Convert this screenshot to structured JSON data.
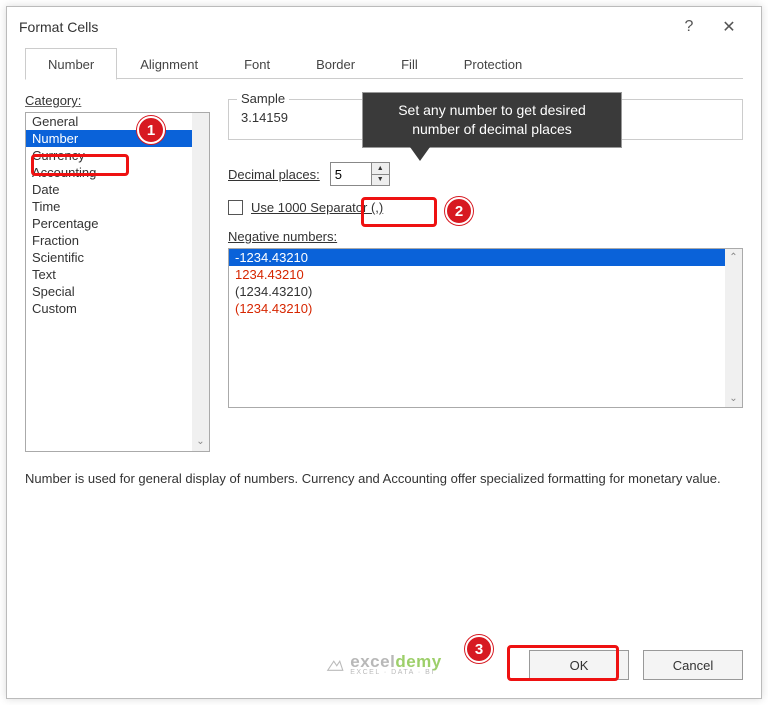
{
  "dialog": {
    "title": "Format Cells"
  },
  "tabs": [
    "Number",
    "Alignment",
    "Font",
    "Border",
    "Fill",
    "Protection"
  ],
  "active_tab": 0,
  "category_label": "Category:",
  "categories": [
    "General",
    "Number",
    "Currency",
    "Accounting",
    "Date",
    "Time",
    "Percentage",
    "Fraction",
    "Scientific",
    "Text",
    "Special",
    "Custom"
  ],
  "selected_category": 1,
  "sample": {
    "legend": "Sample",
    "value": "3.14159"
  },
  "decimal": {
    "label": "Decimal places:",
    "value": "5"
  },
  "separator": {
    "label": "Use 1000 Separator (,)",
    "checked": false
  },
  "negative": {
    "label": "Negative numbers:",
    "items": [
      {
        "text": "-1234.43210",
        "red": false,
        "selected": true
      },
      {
        "text": "1234.43210",
        "red": true,
        "selected": false
      },
      {
        "text": "(1234.43210)",
        "red": false,
        "selected": false
      },
      {
        "text": "(1234.43210)",
        "red": true,
        "selected": false
      }
    ]
  },
  "description": "Number is used for general display of numbers.  Currency and Accounting offer specialized formatting for monetary value.",
  "buttons": {
    "ok": "OK",
    "cancel": "Cancel"
  },
  "callout": "Set any number to get desired number of decimal places",
  "markers": {
    "one": "1",
    "two": "2",
    "three": "3"
  },
  "watermark": {
    "brand1": "excel",
    "brand2": "demy",
    "sub": "EXCEL · DATA · BI"
  }
}
